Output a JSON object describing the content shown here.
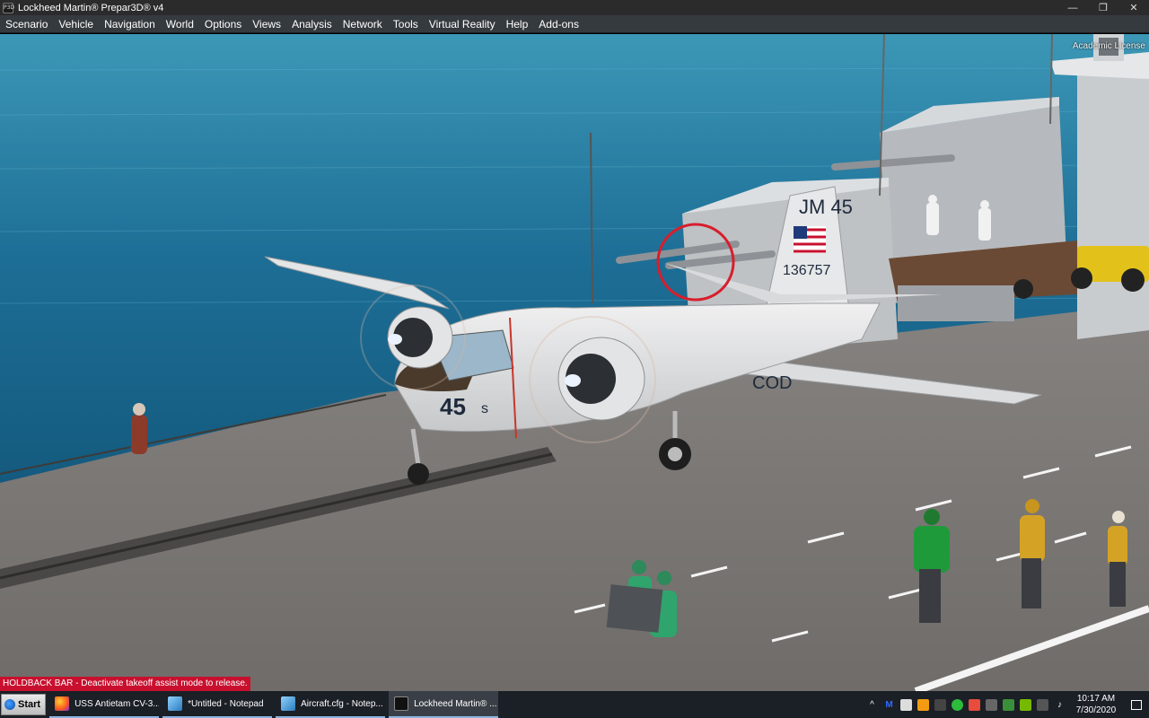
{
  "window": {
    "title": "Lockheed Martin® Prepar3D® v4",
    "app_icon": "P3D",
    "minimize": "—",
    "maximize": "❐",
    "close": "✕"
  },
  "menu": [
    {
      "label": "Scenario"
    },
    {
      "label": "Vehicle"
    },
    {
      "label": "Navigation"
    },
    {
      "label": "World"
    },
    {
      "label": "Options"
    },
    {
      "label": "Views"
    },
    {
      "label": "Analysis"
    },
    {
      "label": "Network"
    },
    {
      "label": "Tools"
    },
    {
      "label": "Virtual Reality"
    },
    {
      "label": "Help"
    },
    {
      "label": "Add-ons"
    }
  ],
  "scene": {
    "license": "Academic License",
    "aircraft": {
      "tail_code": "JM 45",
      "serial": "136757",
      "nose_number": "45",
      "nose_suffix": "s",
      "side_text": "COD"
    },
    "status_message": "HOLDBACK BAR - Deactivate takeoff assist mode to release.",
    "colors": {
      "sea": "#1d6e96",
      "deck": "#7c7975",
      "aircraft": "#e2e3e4",
      "highlight_circle": "#d81e2c",
      "status_bg": "#c8102e"
    }
  },
  "taskbar": {
    "start_label": "Start",
    "tasks": [
      {
        "label": "USS Antietam CV-3...",
        "icon": "firefox-icon"
      },
      {
        "label": "*Untitled - Notepad",
        "icon": "notepad-icon"
      },
      {
        "label": "Aircraft.cfg - Notep...",
        "icon": "notepad-icon"
      },
      {
        "label": "Lockheed Martin® ...",
        "icon": "p3d-icon"
      }
    ],
    "time": "10:17 AM",
    "date": "7/30/2020"
  }
}
